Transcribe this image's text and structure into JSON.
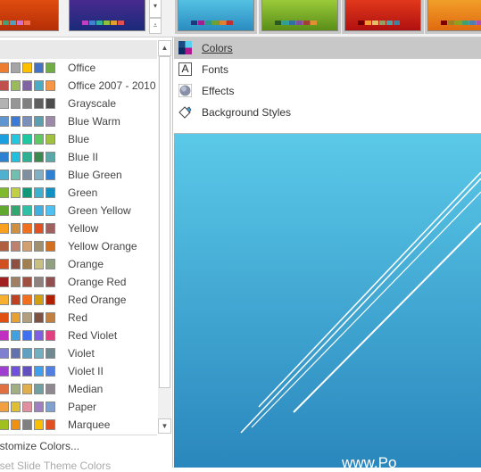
{
  "ribbon": {
    "thumbnails": [
      {
        "bg": "linear-gradient(#e14d10,#b52e06)",
        "swatches": [
          "#d8a050",
          "#45a070",
          "#4fa0c0",
          "#d070d0",
          "#f07050"
        ]
      },
      {
        "bg": "linear-gradient(#4a2a90,#1a2a7a)",
        "swatches": [
          "#c040c0",
          "#4080d0",
          "#30b0a0",
          "#90c040",
          "#e0a030",
          "#e05050"
        ]
      },
      {
        "bg": "linear-gradient(#55c3e4,#2a8cc0)",
        "swatches": [
          "#1a3a80",
          "#a02090",
          "#2a9a90",
          "#70a030",
          "#e08030",
          "#c03030"
        ]
      },
      {
        "bg": "linear-gradient(#9ccc3a,#5a8e18)",
        "swatches": [
          "#2a5a20",
          "#30a090",
          "#3070a0",
          "#8050a0",
          "#a04030",
          "#e09030"
        ]
      },
      {
        "bg": "linear-gradient(#e23a1c,#b01010)",
        "swatches": [
          "#700000",
          "#f0a030",
          "#e0c060",
          "#90a060",
          "#50a0a0",
          "#4080a0"
        ]
      },
      {
        "bg": "linear-gradient(#f2a02a,#e06a10)",
        "swatches": [
          "#800000",
          "#a08020",
          "#90a020",
          "#40a070",
          "#5080b0",
          "#b050b0"
        ]
      }
    ]
  },
  "color_schemes": [
    {
      "name": "Office",
      "colors": [
        "#ed7d31",
        "#a5a5a5",
        "#ffc000",
        "#4472c4",
        "#70ad47"
      ]
    },
    {
      "name": "Office 2007 - 2010",
      "colors": [
        "#c0504d",
        "#9bbb59",
        "#8064a2",
        "#4bacc6",
        "#f79646"
      ]
    },
    {
      "name": "Grayscale",
      "colors": [
        "#b2b2b2",
        "#969696",
        "#808080",
        "#5f5f5f",
        "#4d4d4d"
      ]
    },
    {
      "name": "Blue Warm",
      "colors": [
        "#6096d0",
        "#3a7ad8",
        "#7c8fb8",
        "#5aa0b0",
        "#9c8aa8"
      ]
    },
    {
      "name": "Blue",
      "colors": [
        "#1aa0e0",
        "#20c8e0",
        "#20c8a0",
        "#60c860",
        "#a0c040"
      ]
    },
    {
      "name": "Blue II",
      "colors": [
        "#2e80d0",
        "#20c0e0",
        "#30b090",
        "#3a8a50",
        "#5aa8a8"
      ]
    },
    {
      "name": "Blue Green",
      "colors": [
        "#50b0d0",
        "#70c0b0",
        "#8090a0",
        "#80b0c8",
        "#2e80d0"
      ]
    },
    {
      "name": "Green",
      "colors": [
        "#80b830",
        "#c0d040",
        "#109878",
        "#40b0d0",
        "#1090c0"
      ]
    },
    {
      "name": "Green Yellow",
      "colors": [
        "#60a830",
        "#30a870",
        "#30c0a8",
        "#40b0e0",
        "#50c0f0"
      ]
    },
    {
      "name": "Yellow",
      "colors": [
        "#f8a020",
        "#d09040",
        "#f07020",
        "#e05020",
        "#a06060"
      ]
    },
    {
      "name": "Yellow Orange",
      "colors": [
        "#b06040",
        "#c08070",
        "#d0a070",
        "#a09070",
        "#d07020"
      ]
    },
    {
      "name": "Orange",
      "colors": [
        "#d05020",
        "#905040",
        "#a08050",
        "#c8c080",
        "#90a080"
      ]
    },
    {
      "name": "Orange Red",
      "colors": [
        "#a02020",
        "#a08060",
        "#a05040",
        "#908080",
        "#905050"
      ]
    },
    {
      "name": "Red Orange",
      "colors": [
        "#f8b030",
        "#c04020",
        "#f07020",
        "#d0a010",
        "#b02000"
      ]
    },
    {
      "name": "Red",
      "colors": [
        "#e05010",
        "#e8a030",
        "#b0a080",
        "#805040",
        "#c08040"
      ]
    },
    {
      "name": "Red Violet",
      "colors": [
        "#c030c0",
        "#40a0e0",
        "#4070f0",
        "#8060e0",
        "#e04080"
      ]
    },
    {
      "name": "Violet",
      "colors": [
        "#8080d0",
        "#6070b0",
        "#60a0c0",
        "#70b0c0",
        "#708890"
      ]
    },
    {
      "name": "Violet II",
      "colors": [
        "#a040d0",
        "#7050e0",
        "#6050c0",
        "#40a0f0",
        "#5080e0"
      ]
    },
    {
      "name": "Median",
      "colors": [
        "#e07040",
        "#a0b080",
        "#e0b050",
        "#70a0a0",
        "#908890"
      ]
    },
    {
      "name": "Paper",
      "colors": [
        "#f0a040",
        "#e0c030",
        "#e090a0",
        "#a080c0",
        "#80a0d0"
      ]
    },
    {
      "name": "Marquee",
      "colors": [
        "#a0c020",
        "#f09010",
        "#808080",
        "#f8c000",
        "#e05020"
      ]
    }
  ],
  "left_footer": {
    "customize": "ustomize Colors...",
    "reset": "eset Slide Theme Colors"
  },
  "menu": {
    "items": [
      {
        "label": "Colors",
        "icon": "colors-icon",
        "selected": true
      },
      {
        "label": "Fonts",
        "icon": "fonts-icon"
      },
      {
        "label": "Effects",
        "icon": "effects-icon"
      },
      {
        "label": "Background Styles",
        "icon": "background-styles-icon"
      }
    ],
    "fonts_glyph": "A"
  },
  "scroll": {
    "up": "▲",
    "down": "▼",
    "gallery_down": "▾",
    "gallery_more": "⩡"
  },
  "slide": {
    "watermark": "www.Po"
  }
}
